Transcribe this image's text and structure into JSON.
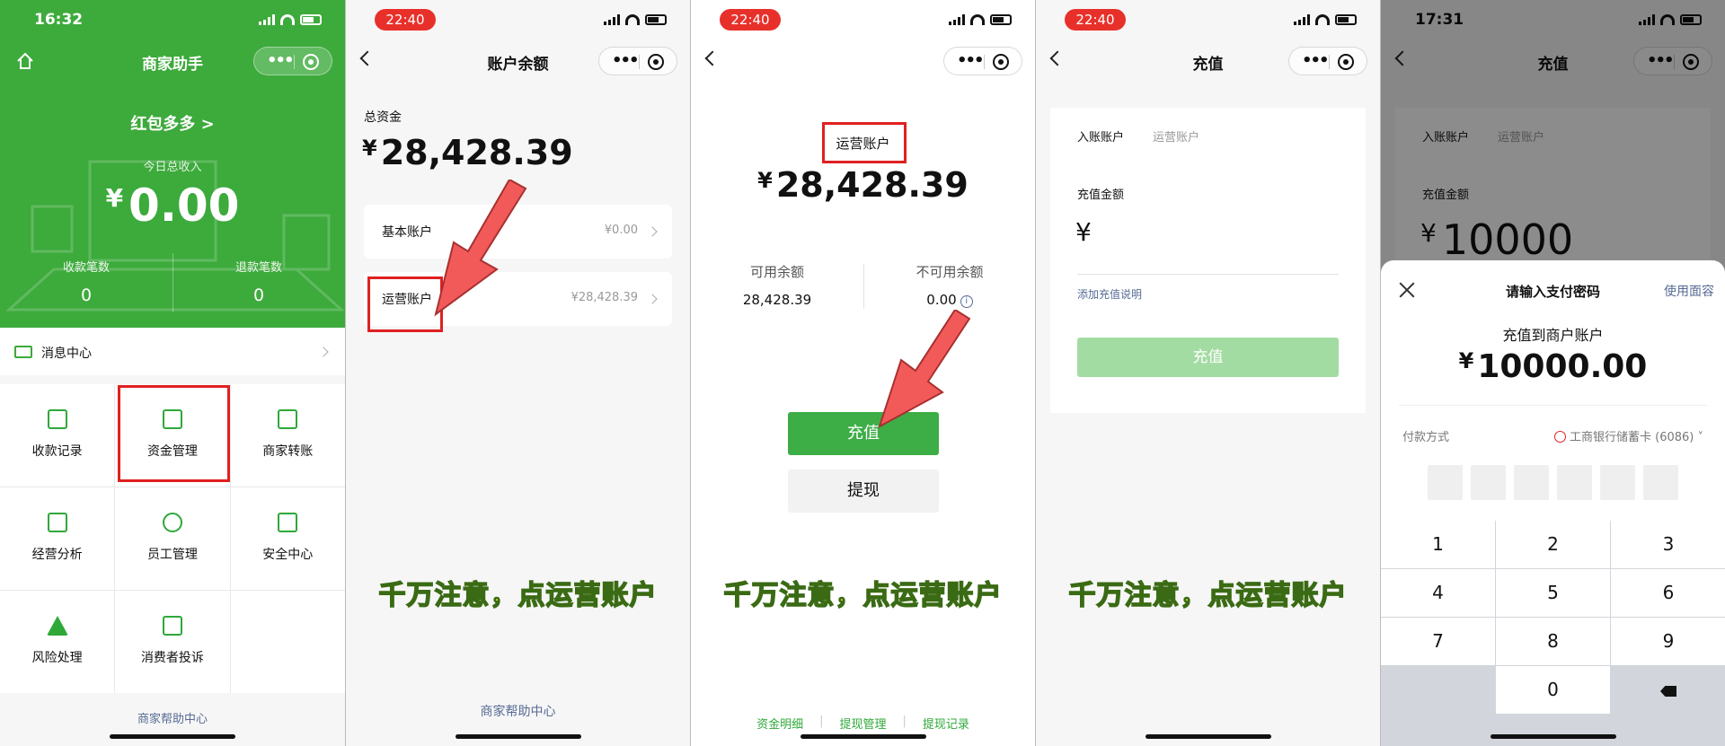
{
  "colors": {
    "accent_green": "#3daa3c",
    "warning_red": "#e02020",
    "link_blue": "#576b95"
  },
  "panel1": {
    "status_time": "16:32",
    "nav_title": "商家助手",
    "hero": {
      "link": "红包多多 >",
      "income_label": "今日总收入",
      "currency": "¥",
      "income_value": "0.00",
      "stat_left_label": "收款笔数",
      "stat_left_value": "0",
      "stat_right_label": "退款笔数",
      "stat_right_value": "0"
    },
    "message_center": "消息中心",
    "grid_items": [
      {
        "label": "收款记录",
        "icon": "receipt-icon"
      },
      {
        "label": "资金管理",
        "icon": "wallet-icon"
      },
      {
        "label": "商家转账",
        "icon": "store-transfer-icon"
      },
      {
        "label": "经营分析",
        "icon": "chart-icon"
      },
      {
        "label": "员工管理",
        "icon": "staff-icon"
      },
      {
        "label": "安全中心",
        "icon": "shield-icon"
      },
      {
        "label": "风险处理",
        "icon": "warning-icon"
      },
      {
        "label": "消费者投诉",
        "icon": "complaint-icon"
      }
    ],
    "footer": "商家帮助中心"
  },
  "panel2": {
    "status_time": "22:40",
    "nav_title": "账户余额",
    "total_label": "总资金",
    "currency": "¥",
    "total_value": "28,428.39",
    "accounts": [
      {
        "name": "基本账户",
        "value": "¥0.00"
      },
      {
        "name": "运营账户",
        "value": "¥28,428.39"
      }
    ],
    "warning": "千万注意，点运营账户",
    "footer": "商家帮助中心"
  },
  "panel3": {
    "status_time": "22:40",
    "account_title": "运营账户",
    "currency": "¥",
    "balance": "28,428.39",
    "available_label": "可用余额",
    "available_value": "28,428.39",
    "unavailable_label": "不可用余额",
    "unavailable_value": "0.00",
    "recharge_button": "充值",
    "withdraw_button": "提现",
    "warning": "千万注意，点运营账户",
    "links": [
      "资金明细",
      "提现管理",
      "提现记录"
    ]
  },
  "panel4": {
    "status_time": "22:40",
    "nav_title": "充值",
    "tab_active": "入账账户",
    "tab_value": "运营账户",
    "amount_label": "充值金额",
    "currency": "¥",
    "note_link": "添加充值说明",
    "submit_button": "充值",
    "warning": "千万注意，点运营账户"
  },
  "panel5": {
    "status_time": "17:31",
    "nav_title": "充值",
    "tab_active": "入账账户",
    "tab_value": "运营账户",
    "amount_label": "充值金额",
    "currency": "¥",
    "amount_entered": "10000",
    "sheet": {
      "title": "请输入支付密码",
      "face_link": "使用面容",
      "to_label": "充值到商户账户",
      "amount": "10000.00",
      "pay_method_label": "付款方式",
      "pay_method_value": "工商银行储蓄卡 (6086)"
    },
    "keys": [
      "1",
      "2",
      "3",
      "4",
      "5",
      "6",
      "7",
      "8",
      "9",
      "0"
    ]
  }
}
